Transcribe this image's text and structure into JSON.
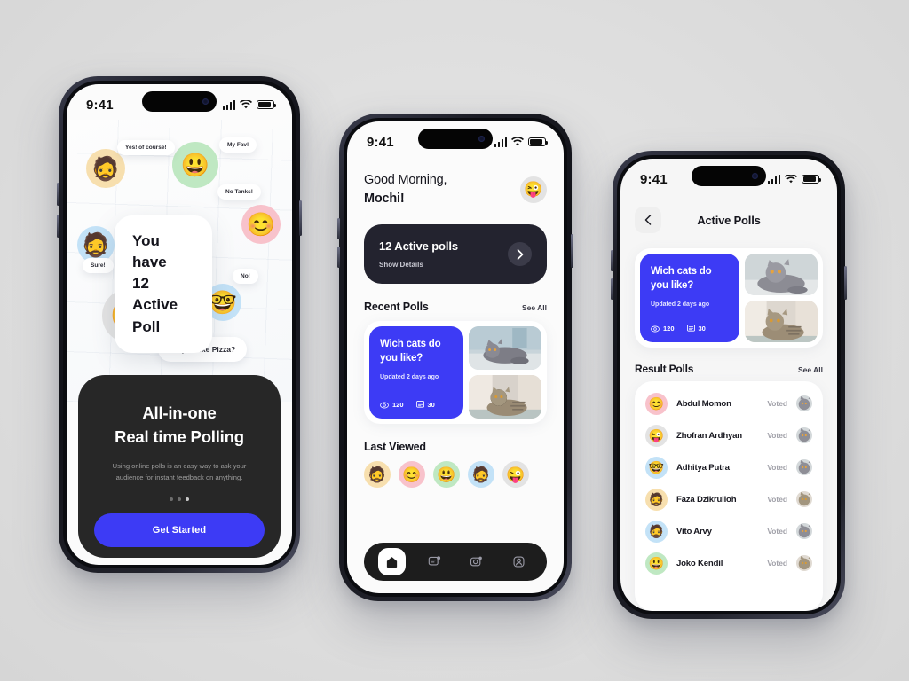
{
  "background_color": "#e2e2e2",
  "accent_blue": "#3d3bf5",
  "dark_card": "#272727",
  "dark_banner": "#23232f",
  "phone1": {
    "status": {
      "time": "9:41",
      "signal_icon": "cellular-signal-icon",
      "wifi_icon": "wifi-icon",
      "battery_icon": "battery-icon"
    },
    "hero": {
      "headline_line1": "You have",
      "headline_line2": "12 Active Poll",
      "bubbles": [
        {
          "text": "Yes! of course!"
        },
        {
          "text": "My Fav!"
        },
        {
          "text": "No Tanks!"
        },
        {
          "text": "Sure!"
        },
        {
          "text": "No!"
        },
        {
          "text": "Do you like Pizza?"
        }
      ],
      "avatars": [
        {
          "name": "memoji-beard-glasses",
          "emoji": "🧔",
          "bg": "#f7dfae"
        },
        {
          "name": "memoji-smiling-man",
          "emoji": "😃",
          "bg": "#bfe8c2"
        },
        {
          "name": "memoji-short-hair-woman",
          "emoji": "😊",
          "bg": "#f8c2cb"
        },
        {
          "name": "memoji-beanie-man",
          "emoji": "🧔",
          "bg": "#c3e2f7"
        },
        {
          "name": "memoji-wink-grey-hair",
          "emoji": "😜",
          "bg": "#e2e2e2"
        },
        {
          "name": "memoji-red-hair-glasses",
          "emoji": "🤓",
          "bg": "#c3e2f7"
        }
      ]
    },
    "card": {
      "title_line1": "All-in-one",
      "title_line2": "Real time Polling",
      "description": "Using online polls is an easy way to ask your audience for instant feedback on anything.",
      "dots_total": 3,
      "dots_active_index": 2,
      "cta_label": "Get Started"
    }
  },
  "phone2": {
    "status": {
      "time": "9:41"
    },
    "greeting": {
      "line1": "Good Morning,",
      "line2": "Mochi!",
      "avatar_emoji": "😜",
      "avatar_bg": "#e2e2e2"
    },
    "banner": {
      "title": "12 Active polls",
      "subtitle": "Show Details",
      "chevron_icon": "chevron-right-icon"
    },
    "recent": {
      "section_title": "Recent Polls",
      "see_all_label": "See All",
      "poll": {
        "question_line1": "Wich cats do",
        "question_line2": "you like?",
        "updated": "Updated 2 days ago",
        "views_icon": "eye-icon",
        "views": "120",
        "votes_icon": "poll-icon",
        "votes": "30",
        "thumb1_name": "grey-cat-photo",
        "thumb2_name": "tabby-cat-photo"
      }
    },
    "last_viewed": {
      "section_title": "Last Viewed",
      "avatars": [
        {
          "name": "memoji-beard-glasses",
          "emoji": "🧔",
          "bg": "#f7dfae"
        },
        {
          "name": "memoji-short-hair-woman",
          "emoji": "😊",
          "bg": "#f8c2cb"
        },
        {
          "name": "memoji-smiling-man",
          "emoji": "😃",
          "bg": "#bfe8c2"
        },
        {
          "name": "memoji-beanie-man",
          "emoji": "🧔",
          "bg": "#c3e2f7"
        },
        {
          "name": "memoji-wink-grey-hair",
          "emoji": "😜",
          "bg": "#e2e2e2"
        }
      ]
    },
    "tabbar": {
      "items": [
        {
          "name": "tab-home",
          "icon": "home-icon",
          "active": true
        },
        {
          "name": "tab-polls",
          "icon": "poll-message-icon",
          "active": false
        },
        {
          "name": "tab-scan",
          "icon": "camera-scan-icon",
          "active": false
        },
        {
          "name": "tab-profile",
          "icon": "user-profile-icon",
          "active": false
        }
      ]
    }
  },
  "phone3": {
    "status": {
      "time": "9:41"
    },
    "nav": {
      "back_icon": "chevron-left-icon",
      "title": "Active Polls"
    },
    "poll": {
      "question_line1": "Wich cats do",
      "question_line2": "you like?",
      "updated": "Updated 2 days ago",
      "views": "120",
      "votes": "30"
    },
    "results": {
      "section_title": "Result Polls",
      "see_all_label": "See All",
      "rows": [
        {
          "name": "Abdul Momon",
          "status": "Voted",
          "avatar_emoji": "😊",
          "avatar_bg": "#f8c2cb",
          "choice_thumb": "grey-cat-photo"
        },
        {
          "name": "Zhofran Ardhyan",
          "status": "Voted",
          "avatar_emoji": "😜",
          "avatar_bg": "#e2e2e2",
          "choice_thumb": "grey-cat-photo"
        },
        {
          "name": "Adhitya Putra",
          "status": "Voted",
          "avatar_emoji": "🤓",
          "avatar_bg": "#c3e2f7",
          "choice_thumb": "grey-cat-photo"
        },
        {
          "name": "Faza Dzikrulloh",
          "status": "Voted",
          "avatar_emoji": "🧔",
          "avatar_bg": "#f7dfae",
          "choice_thumb": "tabby-cat-photo"
        },
        {
          "name": "Vito Arvy",
          "status": "Voted",
          "avatar_emoji": "🧔",
          "avatar_bg": "#c3e2f7",
          "choice_thumb": "grey-cat-photo"
        },
        {
          "name": "Joko Kendil",
          "status": "Voted",
          "avatar_emoji": "😃",
          "avatar_bg": "#bfe8c2",
          "choice_thumb": "tabby-cat-photo"
        }
      ]
    }
  }
}
